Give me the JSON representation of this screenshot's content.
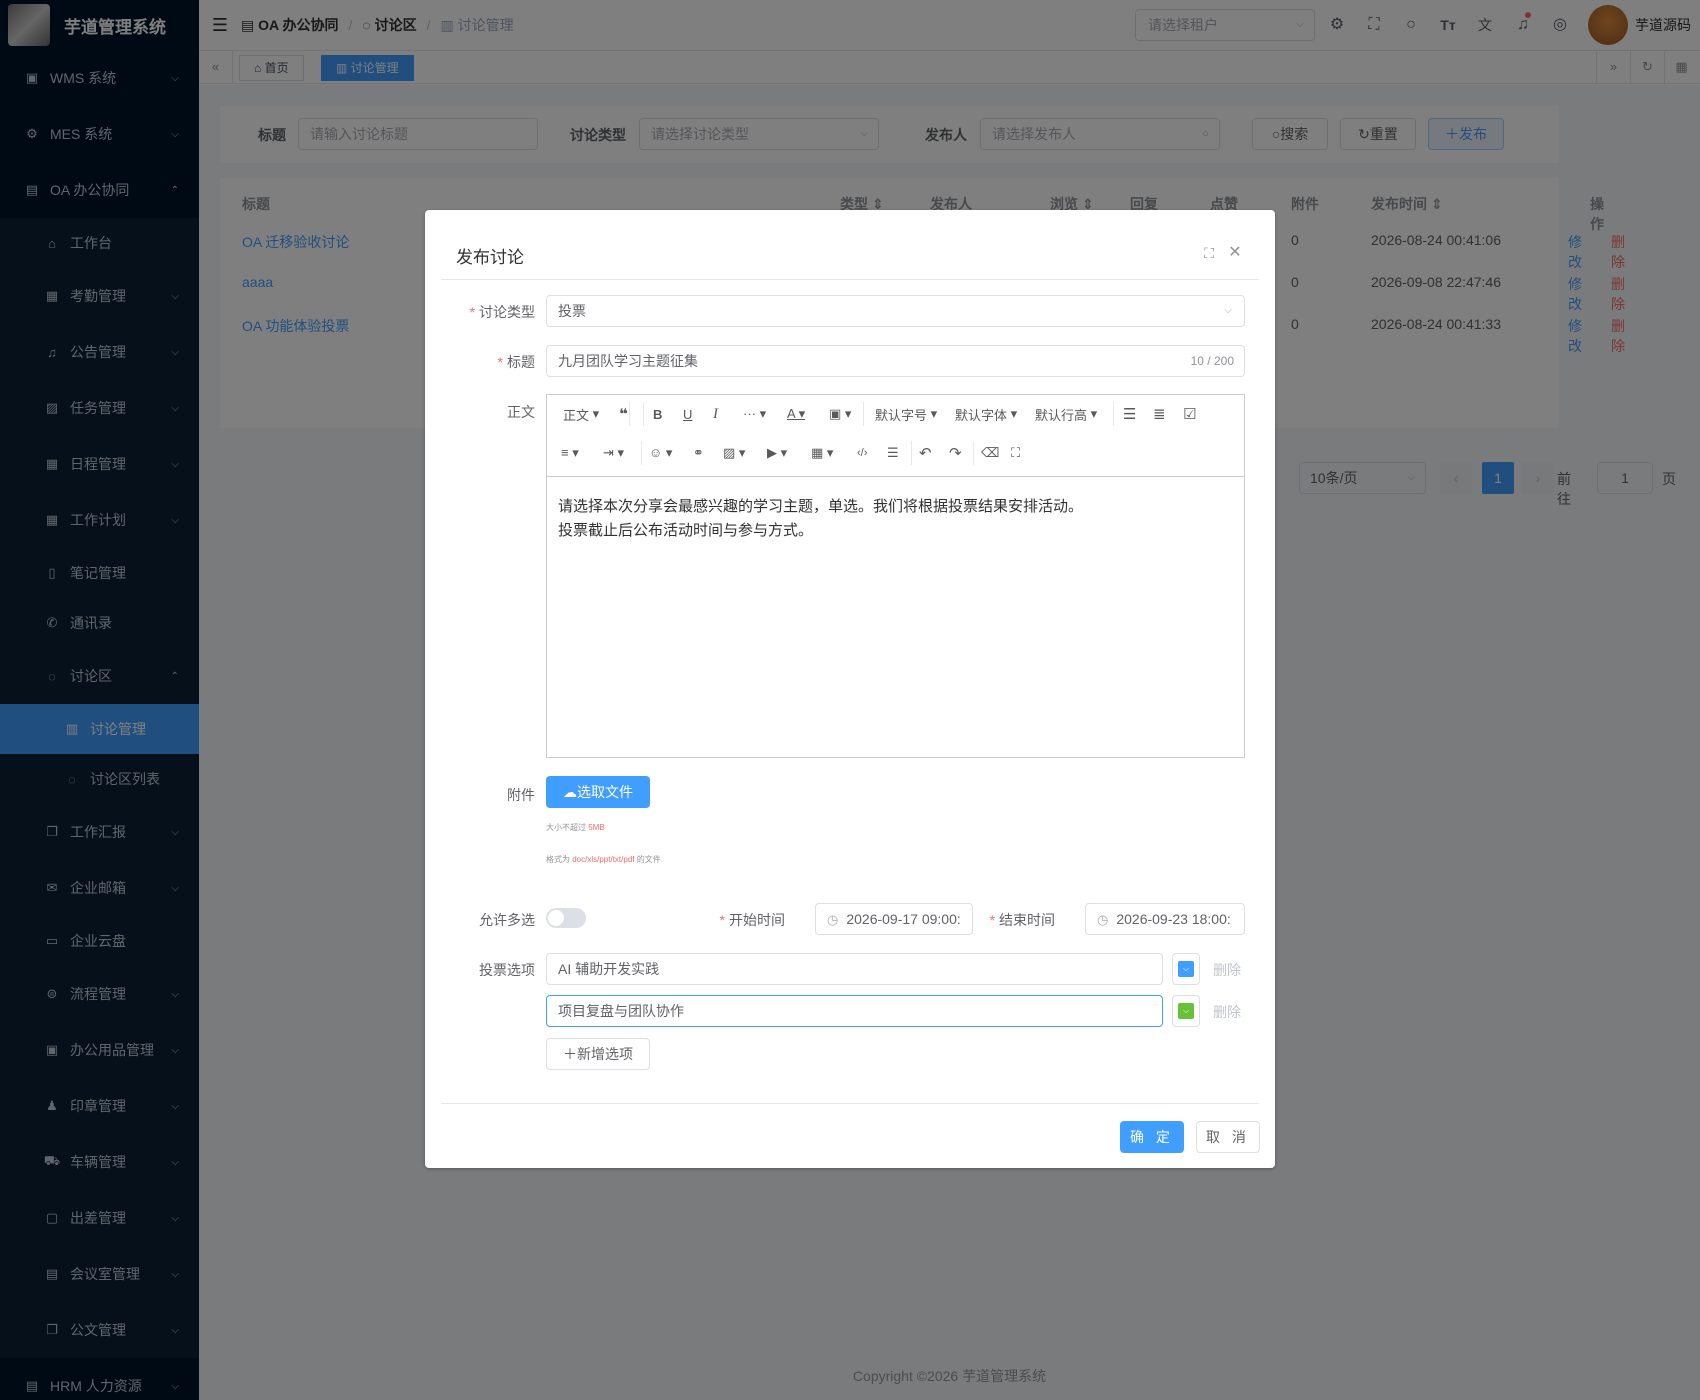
{
  "app": {
    "title": "芋道管理系统"
  },
  "sidebar": {
    "items": [
      {
        "label": "WMS 系统",
        "icon": "box-icon",
        "arrow": "⌵"
      },
      {
        "label": "MES 系统",
        "icon": "gear-icon",
        "arrow": "⌵"
      },
      {
        "label": "OA 办公协同",
        "icon": "building-icon",
        "arrow": "⌃"
      },
      {
        "label": "工作台",
        "icon": "home-icon"
      },
      {
        "label": "考勤管理",
        "icon": "calendar-icon",
        "arrow": "⌵"
      },
      {
        "label": "公告管理",
        "icon": "bell-icon",
        "arrow": "⌵"
      },
      {
        "label": "任务管理",
        "icon": "clipboard-icon",
        "arrow": "⌵"
      },
      {
        "label": "日程管理",
        "icon": "calendar-icon",
        "arrow": "⌵"
      },
      {
        "label": "工作计划",
        "icon": "calendar-icon",
        "arrow": "⌵"
      },
      {
        "label": "笔记管理",
        "icon": "notebook-icon"
      },
      {
        "label": "通讯录",
        "icon": "phone-icon"
      },
      {
        "label": "讨论区",
        "icon": "chat-icon",
        "arrow": "⌃"
      },
      {
        "label": "讨论管理",
        "icon": "chart-icon"
      },
      {
        "label": "讨论区列表",
        "icon": "chat-icon"
      },
      {
        "label": "工作汇报",
        "icon": "copy-icon",
        "arrow": "⌵"
      },
      {
        "label": "企业邮箱",
        "icon": "mail-icon",
        "arrow": "⌵"
      },
      {
        "label": "企业云盘",
        "icon": "folder-icon"
      },
      {
        "label": "流程管理",
        "icon": "flow-icon",
        "arrow": "⌵"
      },
      {
        "label": "办公用品管理",
        "icon": "briefcase-icon",
        "arrow": "⌵"
      },
      {
        "label": "印章管理",
        "icon": "stamp-icon",
        "arrow": "⌵"
      },
      {
        "label": "车辆管理",
        "icon": "truck-icon",
        "arrow": "⌵"
      },
      {
        "label": "出差管理",
        "icon": "suitcase-icon",
        "arrow": "⌵"
      },
      {
        "label": "会议室管理",
        "icon": "building-icon",
        "arrow": "⌵"
      },
      {
        "label": "公文管理",
        "icon": "copy-icon",
        "arrow": "⌵"
      },
      {
        "label": "HRM 人力资源",
        "icon": "building-icon",
        "arrow": "⌵"
      }
    ]
  },
  "header": {
    "breadcrumb": [
      "OA 办公协同",
      "讨论区",
      "讨论管理"
    ],
    "tenant_placeholder": "请选择租户",
    "username": "芋道源码"
  },
  "tags": {
    "home": "首页",
    "current": "讨论管理"
  },
  "search": {
    "title_label": "标题",
    "title_placeholder": "请输入讨论标题",
    "type_label": "讨论类型",
    "type_placeholder": "请选择讨论类型",
    "publisher_label": "发布人",
    "publisher_placeholder": "请选择发布人",
    "search_btn": "搜索",
    "reset_btn": "重置",
    "publish_btn": "发布"
  },
  "table": {
    "headers": [
      "标题",
      "类型",
      "发布人",
      "浏览",
      "回复",
      "点赞",
      "附件",
      "发布时间",
      "操作"
    ],
    "rows": [
      {
        "title": "OA 迁移验收讨论",
        "attach": "0",
        "time": "2026-08-24 00:41:06",
        "edit": "修改",
        "del": "删除"
      },
      {
        "title": "aaaa",
        "attach": "0",
        "time": "2026-09-08 22:47:46",
        "edit": "修改",
        "del": "删除"
      },
      {
        "title": "OA 功能体验投票",
        "attach": "0",
        "time": "2026-08-24 00:41:33",
        "edit": "修改",
        "del": "删除"
      }
    ],
    "page_size": "10条/页",
    "current_page": "1",
    "goto_label": "前往",
    "goto_value": "1",
    "page_suffix": "页"
  },
  "footer": "Copyright ©2026 芋道管理系统",
  "dialog": {
    "title": "发布讨论",
    "type_label": "讨论类型",
    "type_value": "投票",
    "title_label": "标题",
    "title_value": "九月团队学习主题征集",
    "title_counter": "10 / 200",
    "body_label": "正文",
    "editor": {
      "paragraph": "正文",
      "font_size": "默认字号",
      "font_family": "默认字体",
      "line_height": "默认行高",
      "content_line1": "请选择本次分享会最感兴趣的学习主题，单选。我们将根据投票结果安排活动。",
      "content_line2": "投票截止后公布活动时间与参与方式。"
    },
    "attach_label": "附件",
    "upload_btn": "选取文件",
    "tip_size_prefix": "大小不超过 ",
    "tip_size_value": "5MB",
    "tip_format_prefix": "格式为 ",
    "tip_format_value": "doc/xls/ppt/txt/pdf",
    "tip_format_suffix": " 的文件",
    "multi_label": "允许多选",
    "multi_enabled": false,
    "start_label": "开始时间",
    "start_value": "2026-09-17 09:00:",
    "end_label": "结束时间",
    "end_value": "2026-09-23 18:00:",
    "options_label": "投票选项",
    "options": [
      {
        "text": "AI 辅助开发实践",
        "color": "#409eff",
        "delete": "删除"
      },
      {
        "text": "项目复盘与团队协作",
        "color": "#67c23a",
        "delete": "删除"
      }
    ],
    "add_option": "新增选项",
    "confirm": "确 定",
    "cancel": "取 消"
  }
}
